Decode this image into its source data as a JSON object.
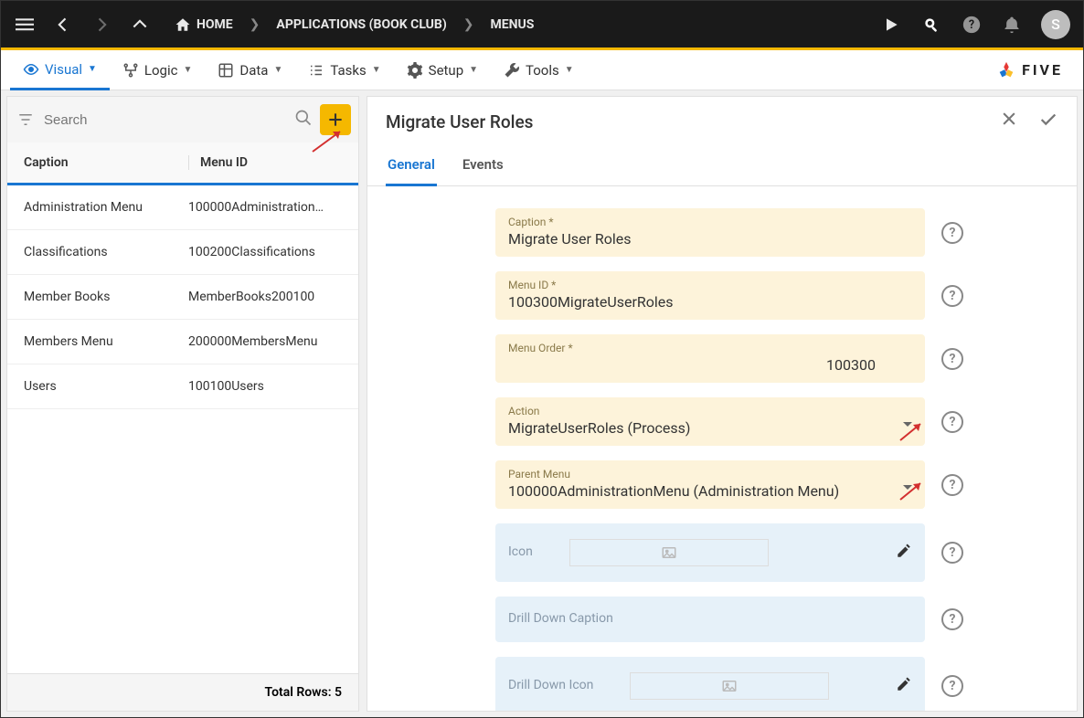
{
  "breadcrumb": {
    "home": "HOME",
    "app": "APPLICATIONS (BOOK CLUB)",
    "section": "MENUS"
  },
  "avatar_letter": "S",
  "menubar": {
    "items": [
      {
        "label": "Visual",
        "icon": "eye"
      },
      {
        "label": "Logic",
        "icon": "flow"
      },
      {
        "label": "Data",
        "icon": "grid"
      },
      {
        "label": "Tasks",
        "icon": "list"
      },
      {
        "label": "Setup",
        "icon": "gear"
      },
      {
        "label": "Tools",
        "icon": "wrench"
      }
    ],
    "logo": "FIVE"
  },
  "left": {
    "search_placeholder": "Search",
    "columns": {
      "caption": "Caption",
      "menuid": "Menu ID"
    },
    "rows": [
      {
        "caption": "Administration Menu",
        "menuid": "100000Administration…"
      },
      {
        "caption": "Classifications",
        "menuid": "100200Classifications"
      },
      {
        "caption": "Member Books",
        "menuid": "MemberBooks200100"
      },
      {
        "caption": "Members Menu",
        "menuid": "200000MembersMenu"
      },
      {
        "caption": "Users",
        "menuid": "100100Users"
      }
    ],
    "total_label": "Total Rows: 5"
  },
  "form": {
    "title": "Migrate User Roles",
    "tabs": {
      "general": "General",
      "events": "Events"
    },
    "fields": {
      "caption": {
        "label": "Caption *",
        "value": "Migrate User Roles"
      },
      "menuid": {
        "label": "Menu ID *",
        "value": "100300MigrateUserRoles"
      },
      "menuorder": {
        "label": "Menu Order *",
        "value": "100300"
      },
      "action": {
        "label": "Action",
        "value": "MigrateUserRoles (Process)"
      },
      "parent": {
        "label": "Parent Menu",
        "value": "100000AdministrationMenu (Administration Menu)"
      },
      "icon": {
        "label": "Icon"
      },
      "drillcaption": {
        "label": "Drill Down Caption"
      },
      "drillicon": {
        "label": "Drill Down Icon"
      }
    }
  }
}
